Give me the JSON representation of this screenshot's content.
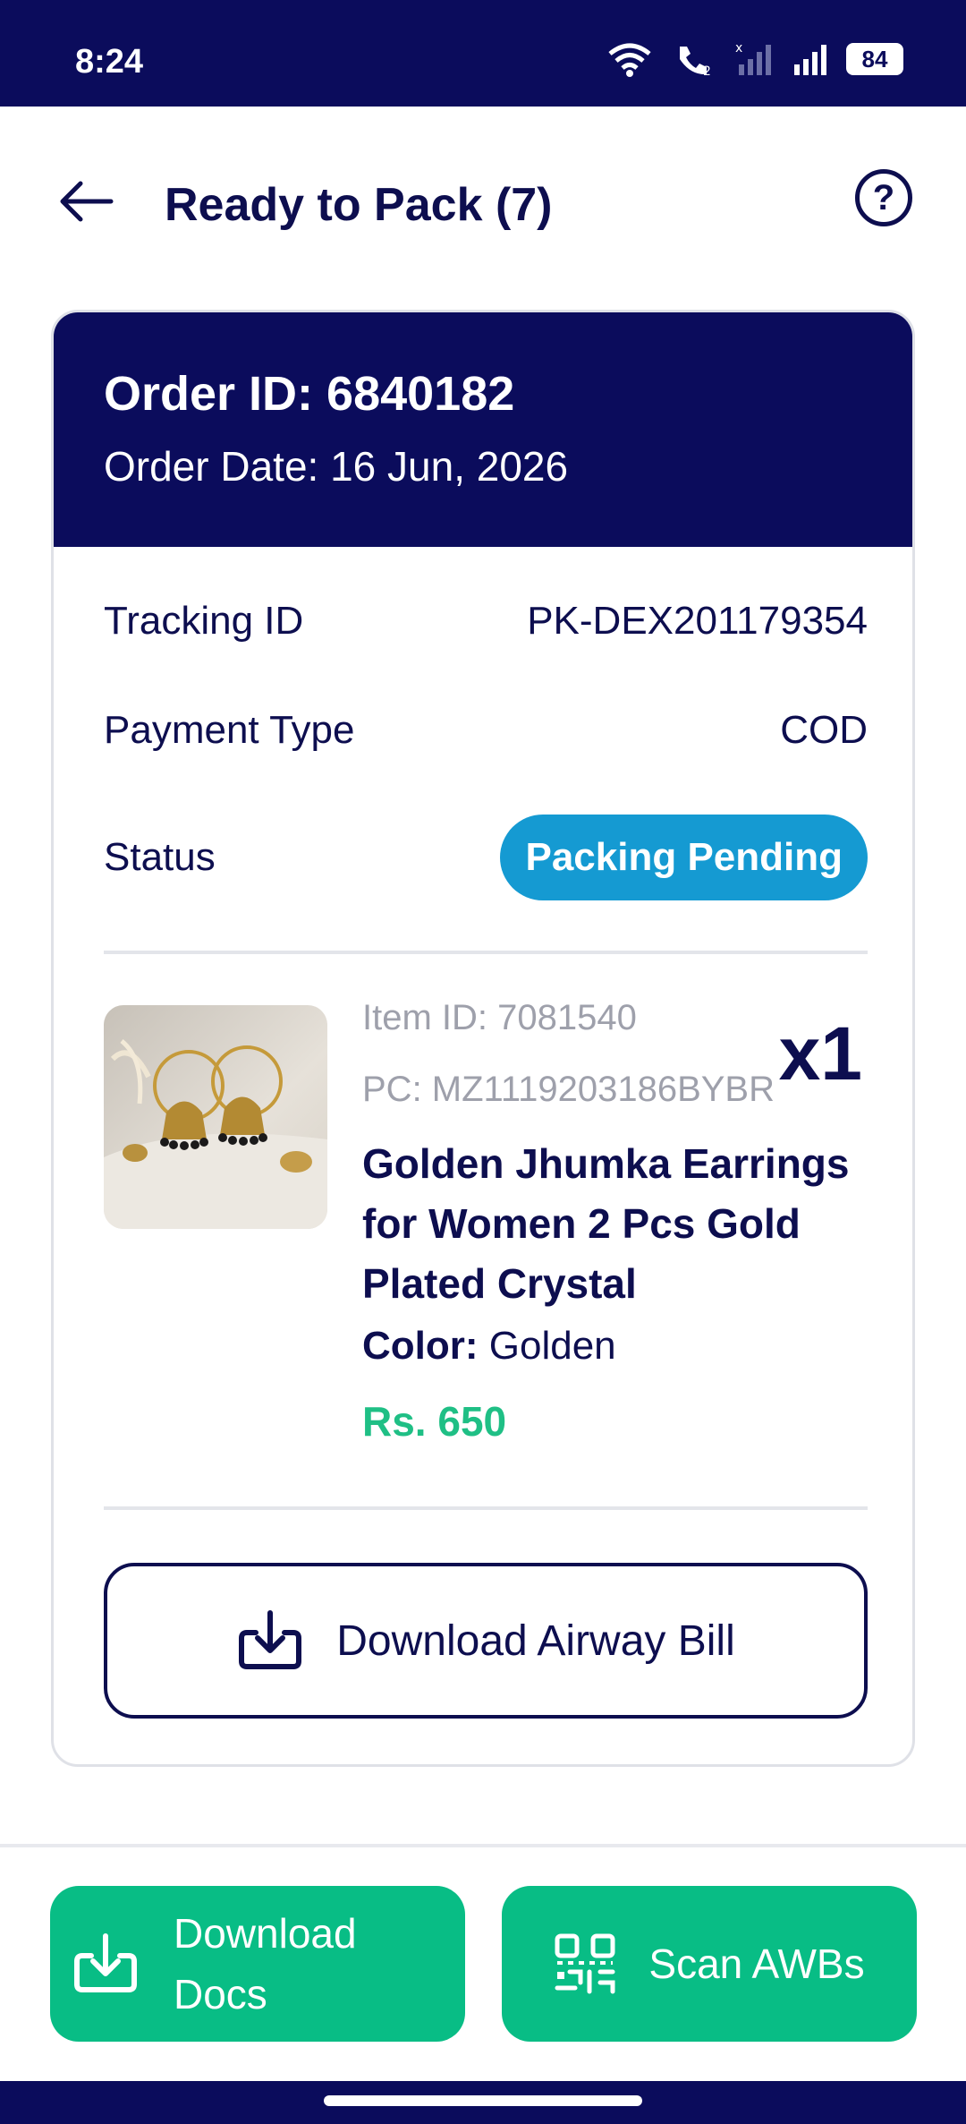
{
  "status_bar": {
    "time": "8:24",
    "battery": "84"
  },
  "header": {
    "title": "Ready to Pack (7)",
    "help_icon": "?"
  },
  "order": {
    "id_text": "Order ID: 6840182",
    "date_text": "Order Date: 16 Jun, 2026",
    "tracking_label": "Tracking ID",
    "tracking_value": "PK-DEX201179354",
    "payment_label": "Payment Type",
    "payment_value": "COD",
    "status_label": "Status",
    "status_value": "Packing Pending",
    "status_color": "#159ad2"
  },
  "item": {
    "item_id": "Item ID: 7081540",
    "pc": "PC: MZ1119203186BYBR",
    "quantity": "x1",
    "title": "Golden Jhumka Earrings for Women 2 Pcs Gold Plated Crystal",
    "color_label": "Color:",
    "color_value": "Golden",
    "price": "Rs. 650",
    "price_color": "#1fbf85"
  },
  "actions": {
    "airway_bill": "Download Airway Bill",
    "download_docs": "Download Docs",
    "scan_awbs": "Scan AWBs"
  },
  "colors": {
    "brand_navy": "#0b0c5c",
    "accent_green": "#08bd85"
  }
}
